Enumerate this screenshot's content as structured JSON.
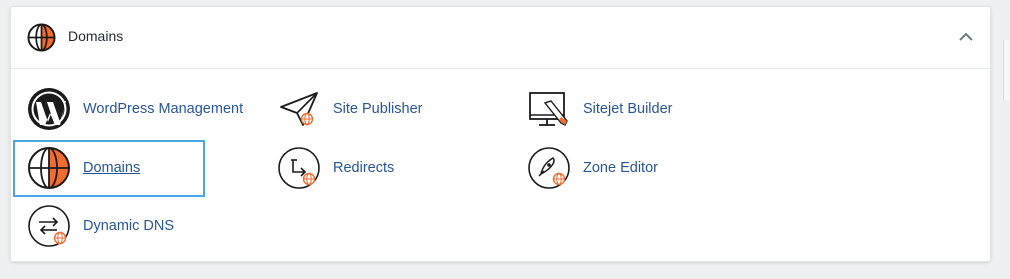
{
  "section": {
    "title": "Domains",
    "collapse_icon": "chevron-up-icon"
  },
  "items": [
    {
      "label": "WordPress Management",
      "icon": "wordpress-icon"
    },
    {
      "label": "Site Publisher",
      "icon": "paper-plane-icon"
    },
    {
      "label": "Sitejet Builder",
      "icon": "monitor-pencil-icon"
    },
    {
      "label": "Domains",
      "icon": "globe-icon",
      "selected": true
    },
    {
      "label": "Redirects",
      "icon": "redirect-icon"
    },
    {
      "label": "Zone Editor",
      "icon": "zone-editor-icon"
    },
    {
      "label": "Dynamic DNS",
      "icon": "exchange-arrows-icon"
    }
  ],
  "colors": {
    "accent_orange": "#f26c2f",
    "link_blue": "#27579a",
    "focus_blue": "#4aa8e6"
  }
}
